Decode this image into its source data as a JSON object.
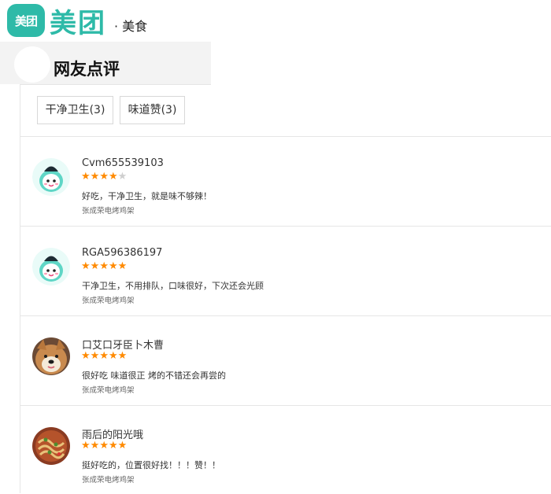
{
  "header": {
    "logo_badge_text": "美团",
    "logo_text": "美团",
    "breadcrumb": "· 美食"
  },
  "section": {
    "title": "网友点评"
  },
  "filters": [
    {
      "label": "干净卫生(3)"
    },
    {
      "label": "味道赞(3)"
    }
  ],
  "reviews": [
    {
      "username": "Cvm655539103",
      "rating": 4,
      "comment": "好吃，干净卫生，就是味不够辣！",
      "shop": "张成荣电烤鸡架",
      "avatar": "mascot-avatar"
    },
    {
      "username": "RGA596386197",
      "rating": 5,
      "comment": "干净卫生，不用排队，口味很好，下次还会光顾",
      "shop": "张成荣电烤鸡架",
      "avatar": "mascot-avatar"
    },
    {
      "username": "口艾口牙臣卜木曹",
      "rating": 5,
      "comment": "很好吃 味道很正 烤的不错还会再尝的",
      "shop": "张成荣电烤鸡架",
      "avatar": "dog-photo-avatar"
    },
    {
      "username": "雨后的阳光哦",
      "rating": 5,
      "comment": "挺好吃的，位置很好找！！！赞！！",
      "shop": "张成荣电烤鸡架",
      "avatar": "food-photo-avatar"
    }
  ],
  "colors": {
    "brand": "#2ebaa8",
    "star_on": "#ff8a00",
    "star_off": "#cfcfcf"
  }
}
